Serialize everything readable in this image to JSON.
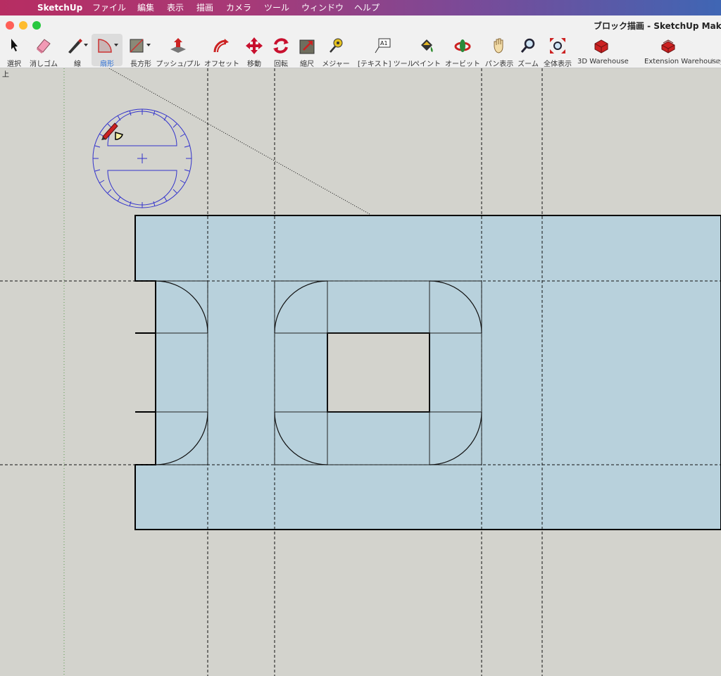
{
  "menubar": {
    "apple": "",
    "app": "SketchUp",
    "items": [
      "ファイル",
      "編集",
      "表示",
      "描画",
      "カメラ",
      "ツール",
      "ウィンドウ",
      "ヘルプ"
    ]
  },
  "window": {
    "title": "ブロック描画 - SketchUp Mak"
  },
  "toolbar": {
    "tools": [
      {
        "label": "選択",
        "icon": "select-arrow-icon"
      },
      {
        "label": "消しゴム",
        "icon": "eraser-icon"
      },
      {
        "label": "線",
        "icon": "pencil-icon"
      },
      {
        "label": "扇形",
        "icon": "pie-arc-icon",
        "active": true
      },
      {
        "label": "長方形",
        "icon": "rectangle-icon"
      },
      {
        "label": "プッシュ/プル",
        "icon": "push-pull-icon"
      },
      {
        "label": "オフセット",
        "icon": "offset-icon"
      },
      {
        "label": "移動",
        "icon": "move-icon"
      },
      {
        "label": "回転",
        "icon": "rotate-icon"
      },
      {
        "label": "縮尺",
        "icon": "scale-icon"
      },
      {
        "label": "メジャー",
        "icon": "tape-measure-icon"
      },
      {
        "label": "[テキスト] ツール",
        "icon": "text-tool-icon",
        "text": "A1"
      },
      {
        "label": "ペイント",
        "icon": "paint-bucket-icon"
      },
      {
        "label": "オービット",
        "icon": "orbit-icon"
      },
      {
        "label": "パン表示",
        "icon": "pan-hand-icon"
      },
      {
        "label": "ズーム",
        "icon": "zoom-icon"
      },
      {
        "label": "全体表示",
        "icon": "zoom-extents-icon"
      },
      {
        "label": "3D Warehouse",
        "icon": "warehouse-icon"
      },
      {
        "label": "Extension Warehouse",
        "icon": "extension-warehouse-icon"
      },
      {
        "label": "Lay",
        "icon": "layout-icon"
      }
    ]
  },
  "viewport": {
    "view_label": "上"
  },
  "colors": {
    "face": "#b8d1dc",
    "background": "#d3d3cd",
    "protractor": "#3333cc",
    "accent": "#2a6fd6"
  }
}
